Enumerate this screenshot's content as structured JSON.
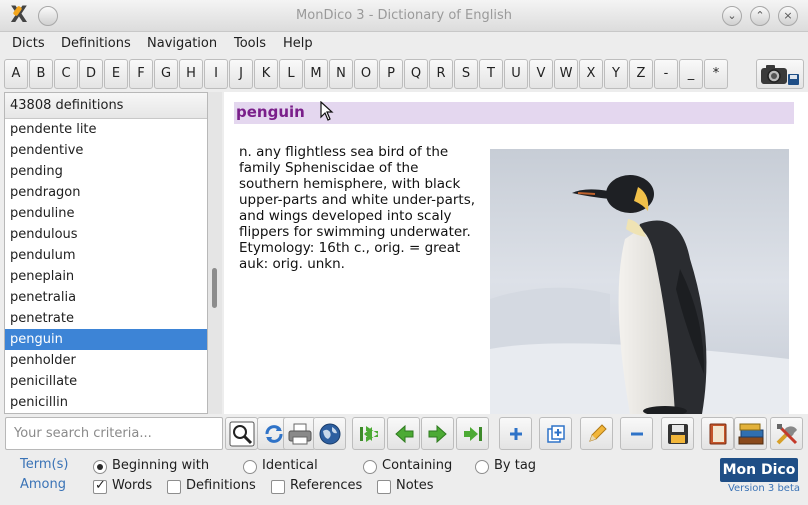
{
  "window": {
    "title": "MonDico 3 - Dictionary of English"
  },
  "menu": [
    {
      "label": "Dicts"
    },
    {
      "label": "Definitions"
    },
    {
      "label": "Navigation"
    },
    {
      "label": "Tools"
    },
    {
      "label": "Help"
    }
  ],
  "alphabet": [
    "A",
    "B",
    "C",
    "D",
    "E",
    "F",
    "G",
    "H",
    "I",
    "J",
    "K",
    "L",
    "M",
    "N",
    "O",
    "P",
    "Q",
    "R",
    "S",
    "T",
    "U",
    "V",
    "W",
    "X",
    "Y",
    "Z",
    "-",
    "_",
    "*"
  ],
  "wordlist": {
    "count_label": "43808 definitions",
    "items": [
      {
        "word": "pendente lite"
      },
      {
        "word": "pendentive"
      },
      {
        "word": "pending"
      },
      {
        "word": "pendragon"
      },
      {
        "word": "penduline"
      },
      {
        "word": "pendulous"
      },
      {
        "word": "pendulum"
      },
      {
        "word": "peneplain"
      },
      {
        "word": "penetralia"
      },
      {
        "word": "penetrate"
      },
      {
        "word": "penguin"
      },
      {
        "word": "penholder"
      },
      {
        "word": "penicillate"
      },
      {
        "word": "penicillin"
      }
    ],
    "selected": "penguin"
  },
  "entry": {
    "headword": "penguin",
    "definition": "n. any flightless sea bird of the family Spheniscidae of the southern hemisphere, with black upper-parts and white under-parts, and wings developed into scaly flippers for swimming underwater.",
    "etymology": "Etymology: 16th c., orig. = great auk: orig. unkn."
  },
  "search": {
    "placeholder": "Your search criteria..."
  },
  "toolbar": [
    {
      "name": "search-icon"
    },
    {
      "name": "refresh-icon"
    },
    {
      "name": "print-icon"
    },
    {
      "name": "globe-icon"
    },
    {
      "name": "first-icon"
    },
    {
      "name": "previous-icon"
    },
    {
      "name": "next-icon"
    },
    {
      "name": "last-icon"
    },
    {
      "name": "add-icon"
    },
    {
      "name": "copy-icon"
    },
    {
      "name": "edit-icon"
    },
    {
      "name": "remove-icon"
    },
    {
      "name": "save-icon"
    },
    {
      "name": "book-icon"
    },
    {
      "name": "books-icon"
    },
    {
      "name": "tools-icon"
    }
  ],
  "options": {
    "terms_label": "Term(s)",
    "among_label": "Among",
    "match_modes": [
      {
        "label": "Beginning with",
        "checked": true
      },
      {
        "label": "Identical",
        "checked": false
      },
      {
        "label": "Containing",
        "checked": false
      },
      {
        "label": "By tag",
        "checked": false
      }
    ],
    "scopes": [
      {
        "label": "Words",
        "checked": true
      },
      {
        "label": "Definitions",
        "checked": false
      },
      {
        "label": "References",
        "checked": false
      },
      {
        "label": "Notes",
        "checked": false
      }
    ]
  },
  "brand": {
    "logo_text": "Mon Dico",
    "version": "Version 3 beta"
  },
  "colors": {
    "selection": "#3d84d6",
    "headword": "#7a1f8a",
    "headword_bg": "#e4d7ef",
    "accent": "#3a73b6",
    "brand": "#1f4e86"
  }
}
